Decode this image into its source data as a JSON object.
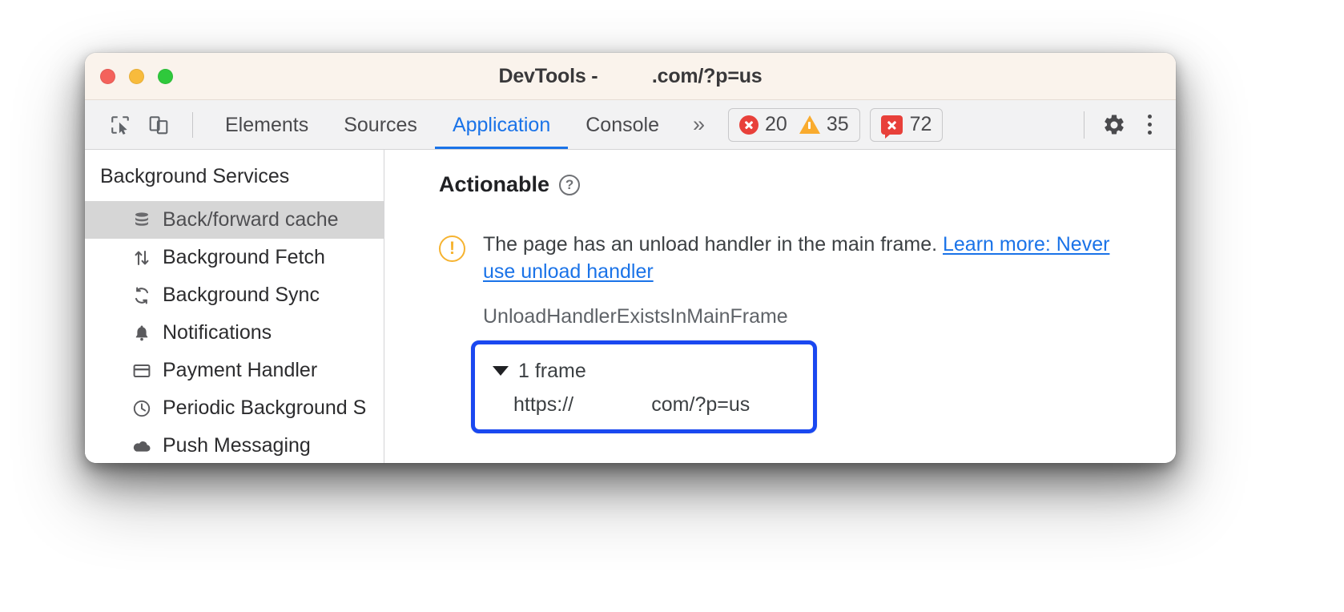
{
  "window": {
    "title": "DevTools -          .com/?p=us",
    "traffic_lights": [
      "close-red",
      "minimize-yellow",
      "maximize-green"
    ]
  },
  "toolbar": {
    "inspect_icon": "inspect-element-icon",
    "device_icon": "device-toolbar-icon",
    "tabs": [
      {
        "label": "Elements",
        "active": false
      },
      {
        "label": "Sources",
        "active": false
      },
      {
        "label": "Application",
        "active": true
      },
      {
        "label": "Console",
        "active": false
      }
    ],
    "more_tabs_label": "»",
    "badges": {
      "errors": {
        "icon": "error-circle-icon",
        "count": "20"
      },
      "warnings": {
        "icon": "warning-triangle-icon",
        "count": "35"
      },
      "issues": {
        "icon": "issue-bubble-icon",
        "count": "72"
      }
    },
    "settings_icon": "gear-icon",
    "menu_icon": "kebab-menu-icon",
    "accent_color": "#1a73e8"
  },
  "sidebar": {
    "header": "Background Services",
    "items": [
      {
        "label": "Back/forward cache",
        "icon": "database-icon",
        "selected": true
      },
      {
        "label": "Background Fetch",
        "icon": "arrows-up-down-icon",
        "selected": false
      },
      {
        "label": "Background Sync",
        "icon": "sync-arrows-icon",
        "selected": false
      },
      {
        "label": "Notifications",
        "icon": "bell-icon",
        "selected": false
      },
      {
        "label": "Payment Handler",
        "icon": "credit-card-icon",
        "selected": false
      },
      {
        "label": "Periodic Background S",
        "icon": "clock-icon",
        "selected": false
      },
      {
        "label": "Push Messaging",
        "icon": "cloud-icon",
        "selected": false
      }
    ]
  },
  "main": {
    "section_title": "Actionable",
    "help_icon": "help-question-icon",
    "issue": {
      "warning_icon": "warning-exclamation-circle-icon",
      "message": "The page has an unload handler in the main frame. ",
      "link_text": "Learn more: Never use unload handler",
      "identifier": "UnloadHandlerExistsInMainFrame"
    },
    "frame_tree": {
      "highlight_color": "#1a48f0",
      "expander_icon": "triangle-down-icon",
      "frame_count_label": "1 frame",
      "frame_url": "https://              com/?p=us"
    }
  }
}
